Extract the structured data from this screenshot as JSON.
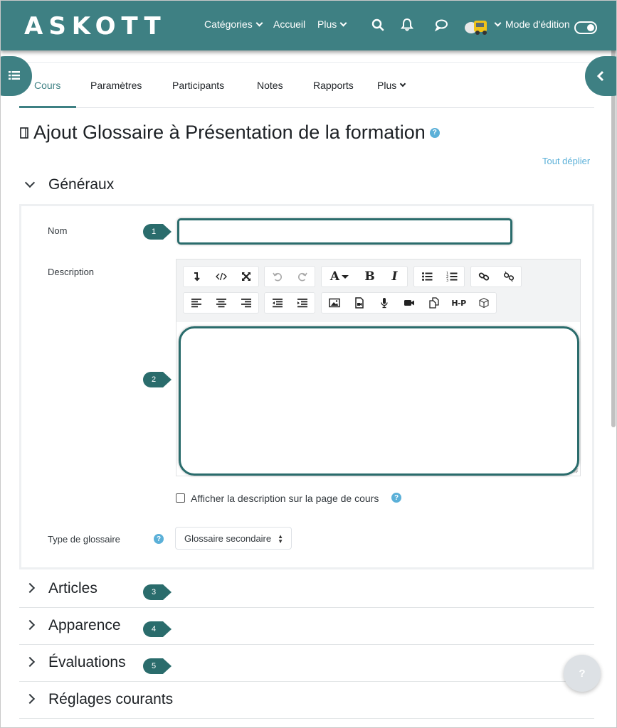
{
  "brand": {
    "logo_text": "ASKOTT",
    "primary_color": "#3e8083",
    "link_color": "#5bb0d8"
  },
  "navbar": {
    "categories": "Catégories",
    "home": "Accueil",
    "more": "Plus",
    "icons": [
      "search-icon",
      "bell-icon",
      "chat-icon"
    ],
    "edit_mode_label": "Mode d'édition",
    "edit_mode_on": true
  },
  "tabs": [
    {
      "label": "Cours",
      "active": true
    },
    {
      "label": "Paramètres",
      "active": false
    },
    {
      "label": "Participants",
      "active": false
    },
    {
      "label": "Notes",
      "active": false
    },
    {
      "label": "Rapports",
      "active": false
    },
    {
      "label": "Plus",
      "active": false
    }
  ],
  "page": {
    "title": "Ajout Glossaire à Présentation de la formation",
    "expand_all": "Tout déplier"
  },
  "general": {
    "heading": "Généraux",
    "name_label": "Nom",
    "name_value": "",
    "description_label": "Description",
    "show_description_label": "Afficher la description sur la page de cours",
    "show_description_checked": false,
    "glossary_type_label": "Type de glossaire",
    "glossary_type_value": "Glossaire secondaire"
  },
  "editor_toolbar": {
    "row1": [
      "toggle-toolbar",
      "html-source",
      "fullscreen",
      "undo",
      "redo",
      "font-color",
      "bold",
      "italic",
      "bullet-list",
      "numbered-list",
      "link",
      "unlink"
    ],
    "row2": [
      "align-left",
      "align-center",
      "align-right",
      "outdent",
      "indent",
      "image",
      "media",
      "record-audio",
      "record-video",
      "manage-files",
      "h5p",
      "content-bank"
    ],
    "font_letter": "A",
    "bold_letter": "B",
    "italic_letter": "I",
    "h5p_text": "H-P"
  },
  "sections": [
    {
      "label": "Articles",
      "callout": "3"
    },
    {
      "label": "Apparence",
      "callout": "4"
    },
    {
      "label": "Évaluations",
      "callout": "5"
    },
    {
      "label": "Réglages courants",
      "callout": ""
    }
  ],
  "callouts": {
    "name": "1",
    "description": "2"
  },
  "float_help": "?"
}
